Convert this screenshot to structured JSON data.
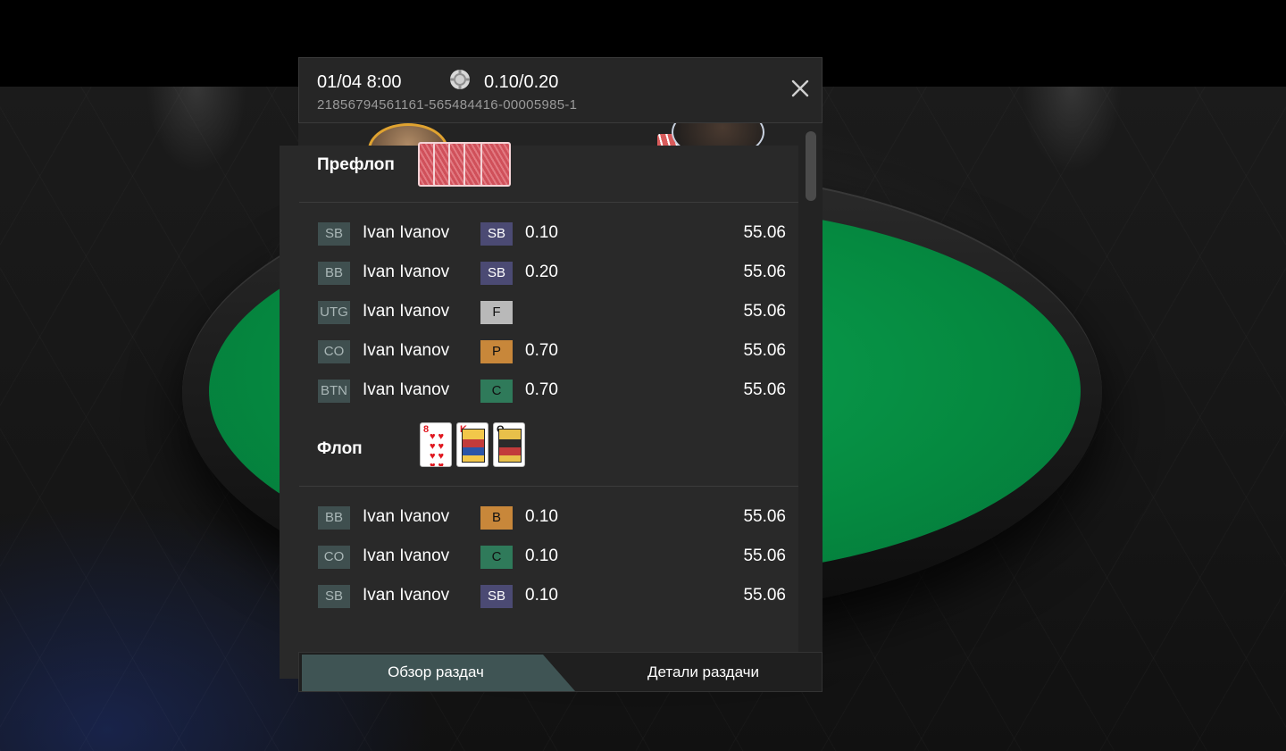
{
  "header": {
    "date": "01/04 8:00",
    "stakes": "0.10/0.20",
    "hand_id": "21856794561161-565484416-00005985-1",
    "chip_icon": "poker-chip-icon",
    "close_icon": "close-icon"
  },
  "streets": [
    {
      "label": "Префлоп",
      "cards": "card-backs",
      "actions": [
        {
          "position": "SB",
          "player": "Ivan Ivanov",
          "action": "SB",
          "amount": "0.10",
          "stack": "55.06"
        },
        {
          "position": "BB",
          "player": "Ivan Ivanov",
          "action": "SB",
          "amount": "0.20",
          "stack": "55.06"
        },
        {
          "position": "UTG",
          "player": "Ivan Ivanov",
          "action": "F",
          "amount": "",
          "stack": "55.06"
        },
        {
          "position": "CO",
          "player": "Ivan Ivanov",
          "action": "P",
          "amount": "0.70",
          "stack": "55.06"
        },
        {
          "position": "BTN",
          "player": "Ivan Ivanov",
          "action": "C",
          "amount": "0.70",
          "stack": "55.06"
        }
      ]
    },
    {
      "label": "Флоп",
      "cards": [
        "8 of hearts",
        "K of diamonds",
        "Q of spades"
      ],
      "actions": [
        {
          "position": "BB",
          "player": "Ivan Ivanov",
          "action": "B",
          "amount": "0.10",
          "stack": "55.06"
        },
        {
          "position": "CO",
          "player": "Ivan Ivanov",
          "action": "C",
          "amount": "0.10",
          "stack": "55.06"
        },
        {
          "position": "SB",
          "player": "Ivan Ivanov",
          "action": "SB",
          "amount": "0.10",
          "stack": "55.06"
        }
      ]
    }
  ],
  "action_colors": {
    "SB": "#4b4a73",
    "F": "#b9b9b9",
    "P": "#c8873a",
    "C": "#2f7a5a",
    "B": "#c8873a"
  },
  "card_texts": {
    "flop_1_rank": "8",
    "flop_2_rank": "K",
    "flop_3_rank": "Q"
  },
  "tabs": {
    "overview": "Обзор раздач",
    "details": "Детали раздачи",
    "active": "overview"
  },
  "colors": {
    "felt": "#058a40",
    "panel": "#292929",
    "position_badge": "#3f4f4f",
    "active_tab": "#3f5454"
  }
}
